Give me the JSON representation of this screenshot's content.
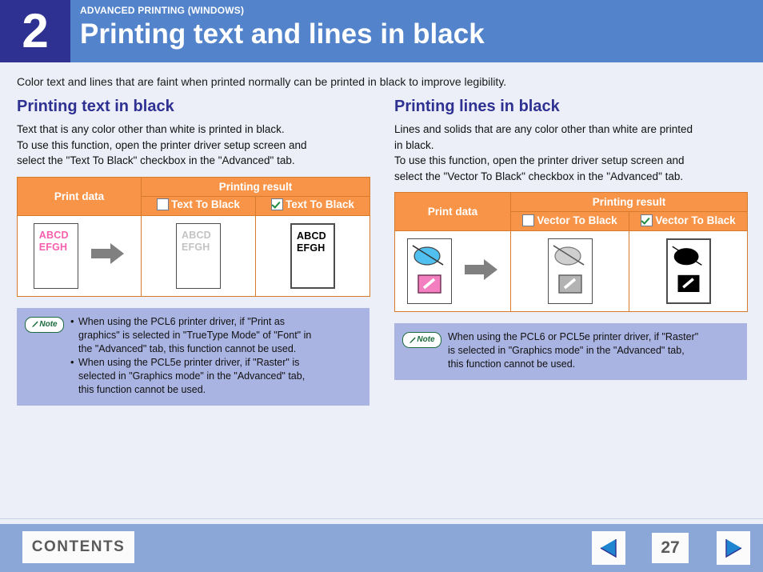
{
  "header": {
    "chapter_number": "2",
    "eyebrow": "ADVANCED PRINTING (WINDOWS)",
    "title": "Printing text and lines in black",
    "accent_color": "#5283cb",
    "chapter_badge_color": "#2e3191"
  },
  "intro": "Color text and lines that are faint when printed normally can be printed in black to improve legibility.",
  "left_section": {
    "title": "Printing text in black",
    "paragraph_lines": [
      "Text that is any color other than white is printed in black.",
      "To use this function, open the printer driver setup screen and",
      "select the \"Text To Black\" checkbox in the \"Advanced\" tab."
    ],
    "table": {
      "col_print_data": "Print data",
      "col_printing_result": "Printing result",
      "sub_unchecked": "Text To Black",
      "sub_checked": "Text To Black",
      "print_data_sheet": {
        "line1": "ABCD",
        "line2": "EFGH",
        "color": "#f75fae"
      },
      "result_unchecked_sheet": {
        "line1": "ABCD",
        "line2": "EFGH",
        "color": "#c3c3c3"
      },
      "result_checked_sheet": {
        "line1": "ABCD",
        "line2": "EFGH",
        "color": "#000000"
      }
    },
    "note": {
      "badge_label": "Note",
      "bullets": [
        [
          "When using the PCL6 printer driver, if \"Print as",
          "graphics\" is selected in \"TrueType Mode\" of \"Font\" in",
          "the \"Advanced\" tab, this function cannot be used."
        ],
        [
          "When using the PCL5e printer driver, if \"Raster\" is",
          "selected in \"Graphics mode\" in the \"Advanced\" tab,",
          "this function cannot be used."
        ]
      ]
    }
  },
  "right_section": {
    "title": "Printing lines in black",
    "paragraph_lines": [
      "Lines and solids that are any color other than white are printed",
      "in black.",
      "To use this function, open the printer driver setup screen and",
      "select the \"Vector To Black\" checkbox in the \"Advanced\" tab."
    ],
    "table": {
      "col_print_data": "Print data",
      "col_printing_result": "Printing result",
      "sub_unchecked": "Vector To Black",
      "sub_checked": "Vector To Black",
      "print_data_shapes": {
        "ellipse_color": "#4fc0ef",
        "rect_color": "#f47fc0"
      },
      "result_unchecked_shapes": {
        "ellipse_color": "#cfcfcf",
        "rect_color": "#b3b3b3"
      },
      "result_checked_shapes": {
        "ellipse_color": "#000000",
        "rect_color": "#000000"
      }
    },
    "note": {
      "badge_label": "Note",
      "lines": [
        "When using the PCL6 or PCL5e printer driver, if \"Raster\"",
        "is selected in \"Graphics mode\" in the \"Advanced\" tab,",
        "this function cannot be used."
      ]
    }
  },
  "footer": {
    "contents_label": "CONTENTS",
    "page_number": "27",
    "prev_icon": "triangle-left-icon",
    "next_icon": "triangle-right-icon"
  }
}
